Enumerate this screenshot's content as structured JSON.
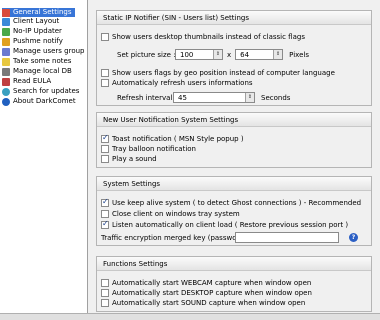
{
  "sidebar": {
    "items": [
      {
        "label": "General Settings",
        "icon": "gear-icon",
        "color": "#d94a3a"
      },
      {
        "label": "Client Layout",
        "icon": "layout-icon",
        "color": "#3a8ad9"
      },
      {
        "label": "No-IP Updater",
        "icon": "no-ip-icon",
        "color": "#4aa84a"
      },
      {
        "label": "Pushme notify",
        "icon": "bell-icon",
        "color": "#e0a020"
      },
      {
        "label": "Manage users group",
        "icon": "users-icon",
        "color": "#6a7ad0"
      },
      {
        "label": "Take some notes",
        "icon": "notes-icon",
        "color": "#e8c840"
      },
      {
        "label": "Manage local DB",
        "icon": "database-icon",
        "color": "#7a7a7a"
      },
      {
        "label": "Read EULA",
        "icon": "document-icon",
        "color": "#c04040"
      },
      {
        "label": "Search for updates",
        "icon": "globe-icon",
        "color": "#3aa0c0"
      },
      {
        "label": "About DarkComet",
        "icon": "info-icon",
        "color": "#2060c0"
      }
    ]
  },
  "static_ip": {
    "header": "Static IP Notifier (SIN - Users list) Settings",
    "show_thumbnails_label": "Show users desktop thumbnails instead of classic flags",
    "picture_size_label": "Set picture size :",
    "width_value": "100",
    "x_label": "x",
    "height_value": "64",
    "pixels_label": "Pixels",
    "geo_flags_label": "Show users flags by geo position instead of computer language",
    "auto_refresh_label": "Automaticaly refresh users informations",
    "refresh_interval_label": "Refresh interval :",
    "refresh_value": "45",
    "seconds_label": "Seconds"
  },
  "notification": {
    "header": "New User Notification System Settings",
    "toast_label": "Toast notification ( MSN Style popup )",
    "tray_label": "Tray balloon notification",
    "sound_label": "Play a sound"
  },
  "system": {
    "header": "System Settings",
    "keep_alive_label": "Use keep alive system ( to detect Ghost connections ) - Recommended",
    "close_tray_label": "Close client on windows tray system",
    "listen_label": "Listen automatically on client load ( Restore previous session port )",
    "traffic_key_label": "Traffic encryption merged key (password) :",
    "traffic_key_value": ""
  },
  "functions": {
    "header": "Functions Settings",
    "webcam_label": "Automatically start WEBCAM capture when window open",
    "desktop_label": "Automatically start DESKTOP capture when window open",
    "sound_label": "Automatically start SOUND capture when window open"
  },
  "colors": {
    "selection": "#3875d7",
    "help": "#2b5fc4"
  }
}
